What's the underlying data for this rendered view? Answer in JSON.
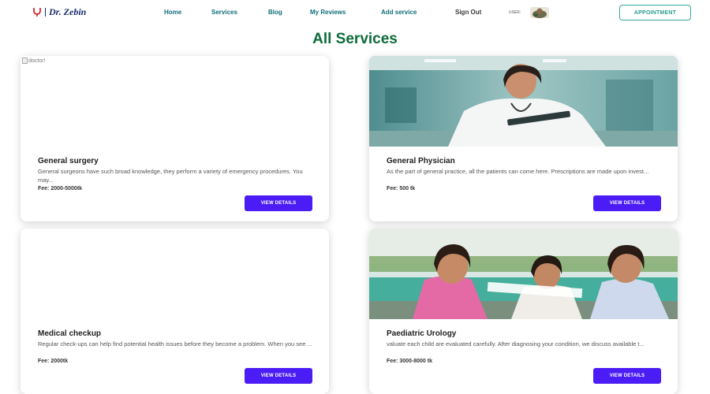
{
  "navbar": {
    "brand": "Dr. Zebin",
    "links": [
      "Home",
      "Services",
      "Blog",
      "My Reviews",
      "Add service"
    ],
    "sign_out": "Sign Out",
    "user_label": "USER:",
    "appointment": "APPOINTMENT"
  },
  "page": {
    "title": "All Services"
  },
  "services": [
    {
      "title": "General surgery",
      "description": "General surgeons have such broad knowledge, they perform a variety of emergency procedures. You may...",
      "fee": "Fee: 2000-5000tk",
      "button": "VIEW DETAILS",
      "image_alt": "doctor!"
    },
    {
      "title": "General Physician",
      "description": "As the part of general practice, all the patients can come here. Prescriptions are made upon invest...",
      "fee": "Fee: 500 tk",
      "button": "VIEW DETAILS"
    },
    {
      "title": "Medical checkup",
      "description": "Regular check-ups can help find potential health issues before they become a problem. When you see ...",
      "fee": "Fee: 2000tk",
      "button": "VIEW DETAILS"
    },
    {
      "title": "Paediatric Urology",
      "description": "valuate each child are evaluated carefully. After diagnosing your condition, we discuss available t...",
      "fee": "Fee: 3000-8000 tk",
      "button": "VIEW DETAILS"
    }
  ],
  "colors": {
    "title_green": "#0d6b3a",
    "nav_teal": "#0f6e7a",
    "button_purple": "#4b1cf5",
    "appointment_border": "#3aa79a"
  },
  "icons": {
    "brand": "doctor-logo-icon"
  }
}
